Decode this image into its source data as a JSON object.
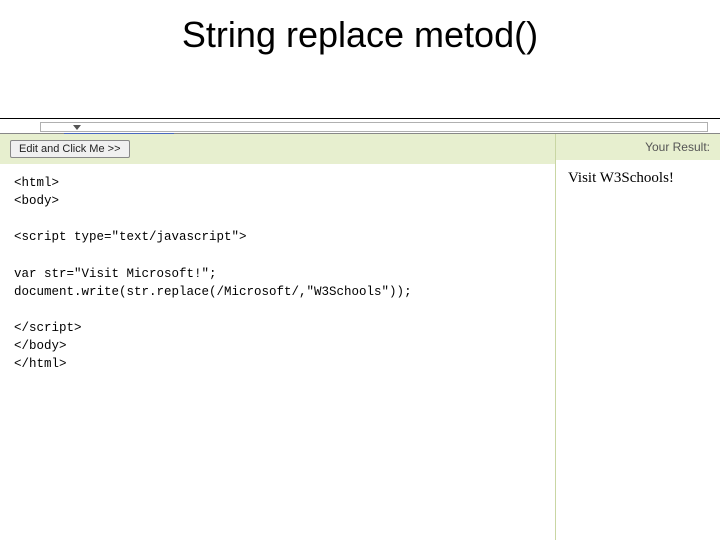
{
  "title": "String replace metod()",
  "left_header_button": "Edit and Click Me >>",
  "right_header": "Your Result:",
  "code": "<html>\n<body>\n\n<script type=\"text/javascript\">\n\nvar str=\"Visit Microsoft!\";\ndocument.write(str.replace(/Microsoft/,\"W3Schools\"));\n\n</script>\n</body>\n</html>",
  "result_text": "Visit W3Schools!"
}
